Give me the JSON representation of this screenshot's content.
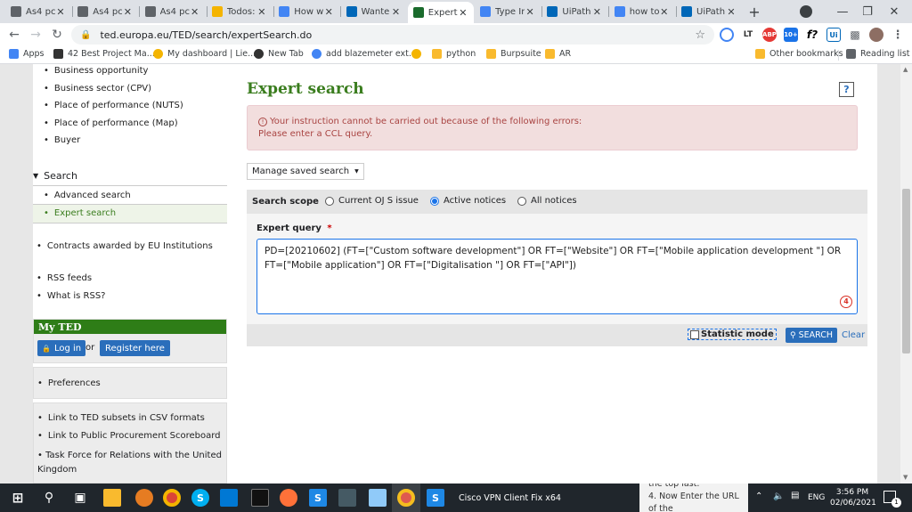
{
  "browser": {
    "tabs": [
      {
        "title": "As4 pc",
        "favicon": "generic-site-icon",
        "color": "#5f6368"
      },
      {
        "title": "As4 pc",
        "favicon": "generic-site-icon",
        "color": "#5f6368"
      },
      {
        "title": "As4 pc",
        "favicon": "generic-site-icon",
        "color": "#5f6368"
      },
      {
        "title": "Todos:",
        "favicon": "todoist-icon",
        "color": "#f4b400"
      },
      {
        "title": "How w",
        "favicon": "google-icon",
        "color": "#4285f4"
      },
      {
        "title": "Wante",
        "favicon": "uipath-icon",
        "color": "#0067b8"
      },
      {
        "title": "Expert",
        "favicon": "ted-icon",
        "color": "#1a6b2c"
      },
      {
        "title": "Type Ir",
        "favicon": "google-icon",
        "color": "#4285f4"
      },
      {
        "title": "UiPath",
        "favicon": "uipath-icon",
        "color": "#0067b8"
      },
      {
        "title": "how to",
        "favicon": "google-icon",
        "color": "#4285f4"
      },
      {
        "title": "UiPath",
        "favicon": "uipath-icon",
        "color": "#0067b8"
      }
    ],
    "new_tab": "+",
    "url": "ted.europa.eu/TED/search/expertSearch.do",
    "bookmarks": [
      {
        "label": "Apps",
        "icon": "apps-grid-icon"
      },
      {
        "label": "42 Best Project Ma...",
        "icon": "s-icon"
      },
      {
        "label": "My dashboard | Lie...",
        "icon": "todoist-icon"
      },
      {
        "label": "New Tab",
        "icon": "globe-icon"
      },
      {
        "label": "add blazemeter ext...",
        "icon": "google-icon"
      },
      {
        "label": "",
        "icon": "todoist-icon"
      },
      {
        "label": "python",
        "icon": "folder-icon"
      },
      {
        "label": "Burpsuite",
        "icon": "folder-icon"
      },
      {
        "label": "AR",
        "icon": "folder-icon"
      },
      {
        "label": "Other bookmarks",
        "icon": "folder-icon"
      },
      {
        "label": "Reading list",
        "icon": "reading-list-icon"
      }
    ]
  },
  "sidebar": {
    "top_items": [
      "Business opportunity",
      "Business sector (CPV)",
      "Place of performance (NUTS)",
      "Place of performance (Map)",
      "Buyer"
    ],
    "search_heading": "Search",
    "search_items": [
      "Advanced search",
      "Expert search"
    ],
    "contracts_item": "Contracts awarded by EU Institutions",
    "rss_items": [
      "RSS feeds",
      "What is RSS?"
    ],
    "myted_title": "My TED",
    "login_label": "Log in",
    "or_label": "or",
    "register_label": "Register here",
    "preferences_label": "Preferences",
    "links": [
      "Link to TED subsets in CSV formats",
      "Link to Public Procurement Scoreboard",
      "Task Force for Relations with the United Kingdom"
    ]
  },
  "main": {
    "title": "Expert search",
    "help_label": "?",
    "error_line1": "Your instruction cannot be carried out because of the following errors:",
    "error_line2": "Please enter a CCL query.",
    "manage_saved_label": "Manage saved search",
    "search_scope_label": "Search scope",
    "scope_options": [
      "Current OJ S issue",
      "Active notices",
      "All notices"
    ],
    "scope_selected": "Active notices",
    "expert_query_label": "Expert query",
    "required_mark": "*",
    "query_text": "PD=[20210602] (FT=[\"Custom software development\"] OR FT=[\"Website\"] OR FT=[\"Mobile application development \"] OR FT=[\"Mobile application\"] OR FT=[\"Digitalisation \"] OR FT=[\"API\"])",
    "grammar_badge": "4",
    "statistic_mode_label": "Statistic mode",
    "statistic_mode_checked": false,
    "search_button": "SEARCH",
    "clear_link": "Clear"
  },
  "taskbar": {
    "active_window": "Cisco VPN Client Fix x64",
    "background_text_1": "the top last.",
    "background_text_2": "4. Now Enter the URL of the",
    "lang": "ENG",
    "time": "3:56 PM",
    "date": "02/06/2021",
    "notification_count": "1"
  },
  "colors": {
    "ted_green": "#3a7d1e",
    "error_bg": "#f2dede",
    "error_text": "#a94442",
    "button_blue": "#2a6ebb",
    "myted_green": "#2e7d17"
  }
}
